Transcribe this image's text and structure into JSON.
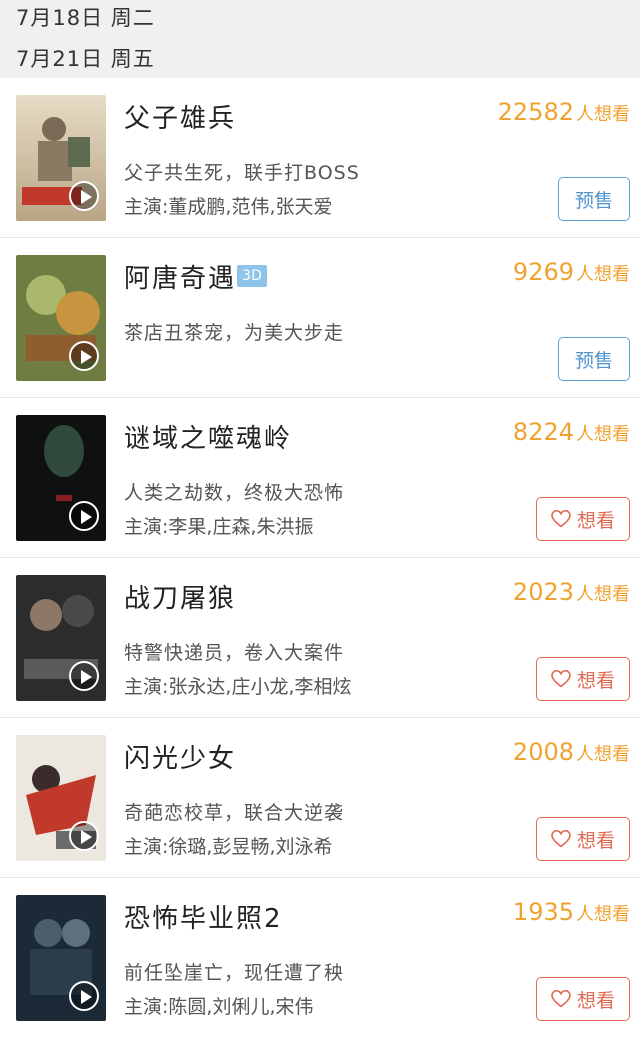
{
  "dates": {
    "d1": "7月18日 周二",
    "d2": "7月21日 周五"
  },
  "movies": [
    {
      "title": "父子雄兵",
      "count": "22582",
      "unit": "人想看",
      "desc": "父子共生死，联手打BOSS",
      "cast": "主演:董成鹏,范伟,张天爱",
      "button": "预售",
      "button_type": "presale",
      "poster_colors": [
        "#d9c7a8",
        "#c0392b"
      ]
    },
    {
      "title": "阿唐奇遇",
      "badge": "3D",
      "count": "9269",
      "unit": "人想看",
      "desc": "茶店丑茶宠，为美大步走",
      "cast": "",
      "button": "预售",
      "button_type": "presale",
      "poster_colors": [
        "#7a8b4a",
        "#c98a3c"
      ]
    },
    {
      "title": "谜域之噬魂岭",
      "count": "8224",
      "unit": "人想看",
      "desc": "人类之劫数，终极大恐怖",
      "cast": "主演:李果,庄森,朱洪振",
      "button": "想看",
      "button_type": "want",
      "poster_colors": [
        "#0e0f0f",
        "#2f4a3a"
      ]
    },
    {
      "title": "战刀屠狼",
      "count": "2023",
      "unit": "人想看",
      "desc": "特警快递员，卷入大案件",
      "cast": "主演:张永达,庄小龙,李相炫",
      "button": "想看",
      "button_type": "want",
      "poster_colors": [
        "#2b2b2b",
        "#7a7a7a"
      ]
    },
    {
      "title": "闪光少女",
      "count": "2008",
      "unit": "人想看",
      "desc": "奇葩恋校草，联合大逆袭",
      "cast": "主演:徐璐,彭昱畅,刘泳希",
      "button": "想看",
      "button_type": "want",
      "poster_colors": [
        "#e8e2da",
        "#c0392b"
      ]
    },
    {
      "title": "恐怖毕业照2",
      "count": "1935",
      "unit": "人想看",
      "desc": "前任坠崖亡，现任遭了秧",
      "cast": "主演:陈圆,刘俐儿,宋伟",
      "button": "想看",
      "button_type": "want",
      "poster_colors": [
        "#1a2a35",
        "#5d7080"
      ]
    }
  ]
}
